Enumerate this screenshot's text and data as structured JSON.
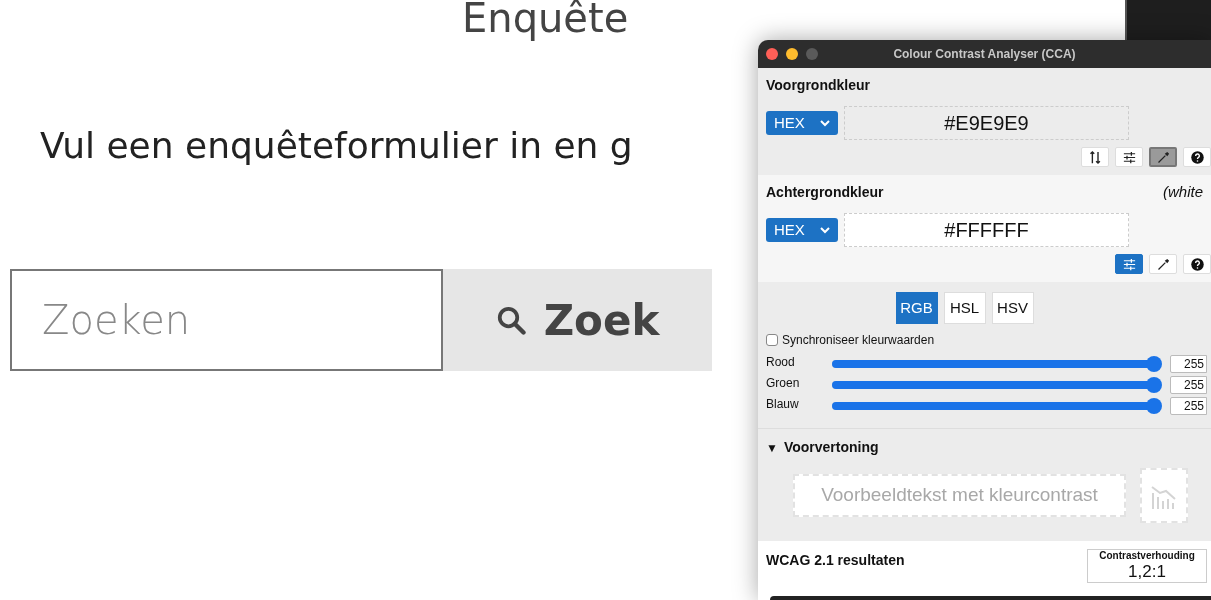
{
  "page": {
    "heading": "Enquête",
    "intro": "Vul een enquêteformulier in en g",
    "search": {
      "placeholder": "Zoeken",
      "button": "Zoek"
    }
  },
  "cca_window": {
    "title": "Colour Contrast Analyser (CCA)",
    "foreground": {
      "label": "Voorgrondkleur",
      "format": "HEX",
      "value": "#E9E9E9",
      "tools": [
        {
          "kind": "swap",
          "selected": false
        },
        {
          "kind": "sliders",
          "selected": false
        },
        {
          "kind": "eyedropper",
          "selected": true
        },
        {
          "kind": "help",
          "selected": false
        }
      ]
    },
    "background": {
      "label": "Achtergrondkleur",
      "color_name": "(white",
      "format": "HEX",
      "value": "#FFFFFF",
      "tools": [
        {
          "kind": "sliders",
          "selected": true
        },
        {
          "kind": "eyedropper",
          "selected": false
        },
        {
          "kind": "help",
          "selected": false
        }
      ]
    },
    "color_model_tabs": [
      {
        "label": "RGB",
        "selected": true
      },
      {
        "label": "HSL",
        "selected": false
      },
      {
        "label": "HSV",
        "selected": false
      }
    ],
    "sync": {
      "label": "Synchroniseer kleurwaarden",
      "checked": false
    },
    "channels": [
      {
        "name": "Rood",
        "level": 1,
        "value": "255"
      },
      {
        "name": "Groen",
        "level": 1,
        "value": "255"
      },
      {
        "name": "Blauw",
        "level": 1,
        "value": "255"
      }
    ],
    "preview": {
      "toggle": "▼",
      "title": "Voorvertoning",
      "expanded": true,
      "sample_text": "Voorbeeldtekst met kleurcontrast"
    },
    "results": {
      "title": "WCAG 2.1 resultaten",
      "ratio_label": "Contrastverhouding",
      "ratio": "1,2:1"
    }
  }
}
